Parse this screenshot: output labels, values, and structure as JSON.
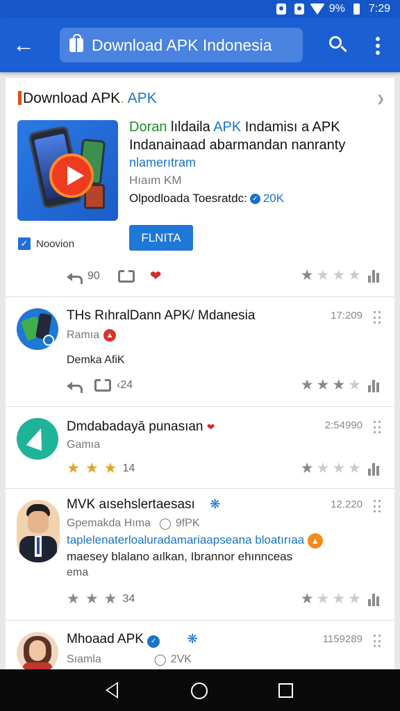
{
  "status_bar": {
    "battery": "9%",
    "time": "7:29"
  },
  "app_bar": {
    "search_text": "Download APK Indonesia"
  },
  "featured": {
    "header_main": "Download APK",
    "header_dot": ".",
    "header_apk": "APK",
    "line1_green": "Doran",
    "line1_mid": "lıldaila",
    "line1_blue": "APK",
    "line1_end": "Indamisı a APK",
    "line2": "Indanainaad abarmandan nanranty",
    "line3": "nlamerıtram",
    "line4": "Hıaım KM",
    "line5_text": "Olpodloada Toesratdc:",
    "line5_count": "20K",
    "install_label": "FLNITA",
    "check_label": "Noovion",
    "reply_count": "90"
  },
  "posts": [
    {
      "name": "THs RıhralDann APK/ Mdanesia",
      "sub": "Ramıa",
      "body": "Demka AfiK",
      "time": "17:209",
      "reply_count": "‹24"
    },
    {
      "name": "Dmdabadayā punasıan",
      "sub": "Gamıa",
      "time": "2:54990",
      "star_count": "14"
    },
    {
      "name": "MVK aısehslertaesası",
      "sub": "Gpemakda Hıma",
      "sub_extra": "9fPK",
      "body_blue": "taplelenaterloaluradamariaapseana bloatırıaa",
      "body_line2": "maesey blalano aılkan, Ibrannor ehınnceas",
      "body_line3": "ema",
      "time": "12.220",
      "star_count": "34"
    },
    {
      "name": "Mhoaad APK",
      "sub": "Sıamla",
      "sub_extra": "2VK",
      "time": "1159289"
    }
  ]
}
